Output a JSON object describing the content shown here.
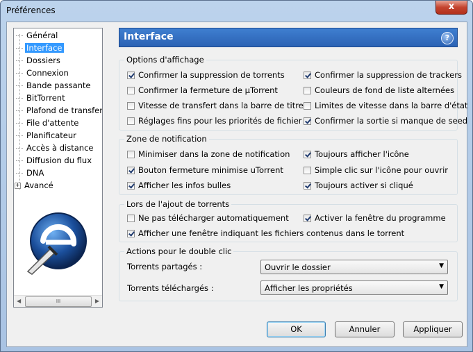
{
  "window": {
    "title": "Préférences",
    "close_glyph": "x"
  },
  "tree": {
    "items": [
      "Général",
      "Interface",
      "Dossiers",
      "Connexion",
      "Bande passante",
      "BitTorrent",
      "Plafond de transfert",
      "File d'attente",
      "Planificateur",
      "Accès à distance",
      "Diffusion du flux",
      "DNA",
      "Avancé"
    ],
    "selected": "Interface",
    "expander_glyph": "+",
    "scroll_thumb": "III"
  },
  "header": {
    "title": "Interface",
    "help_glyph": "?"
  },
  "display_options": {
    "title": "Options d'affichage",
    "items": [
      {
        "label": "Confirmer la suppression de torrents",
        "checked": true
      },
      {
        "label": "Confirmer la suppression de trackers",
        "checked": true
      },
      {
        "label": "Confirmer la fermeture de µTorrent",
        "checked": false
      },
      {
        "label": "Couleurs de fond de liste alternées",
        "checked": false
      },
      {
        "label": "Vitesse de transfert dans la barre de titre",
        "checked": false
      },
      {
        "label": "Limites de vitesse dans la barre d'état",
        "checked": false
      },
      {
        "label": "Réglages fins pour les priorités de fichier",
        "checked": false
      },
      {
        "label": "Confirmer la sortie si manque de seed",
        "checked": true
      }
    ]
  },
  "tray": {
    "title": "Zone de notification",
    "items": [
      {
        "label": "Minimiser dans la zone de notification",
        "checked": false
      },
      {
        "label": "Toujours afficher l'icône",
        "checked": true
      },
      {
        "label": "Bouton fermeture minimise uTorrent",
        "checked": true
      },
      {
        "label": "Simple clic sur l'icône pour ouvrir",
        "checked": false
      },
      {
        "label": "Afficher les infos bulles",
        "checked": true
      },
      {
        "label": "Toujours activer si cliqué",
        "checked": true
      }
    ]
  },
  "adding": {
    "title": "Lors de l'ajout de torrents",
    "items": [
      {
        "label": "Ne pas télécharger automatiquement",
        "checked": false
      },
      {
        "label": "Activer la fenêtre du programme",
        "checked": true
      },
      {
        "label": "Afficher une fenêtre indiquant les fichiers contenus dans le torrent",
        "checked": true
      }
    ]
  },
  "double_click": {
    "title": "Actions pour le double clic",
    "seeding_label": "Torrents partagés :",
    "seeding_value": "Ouvrir le dossier",
    "downloading_label": "Torrents téléchargés :",
    "downloading_value": "Afficher les propriétés"
  },
  "buttons": {
    "ok": "OK",
    "cancel": "Annuler",
    "apply": "Appliquer"
  },
  "colors": {
    "header_bg": "#2f6cc0",
    "selection": "#3399ff"
  }
}
